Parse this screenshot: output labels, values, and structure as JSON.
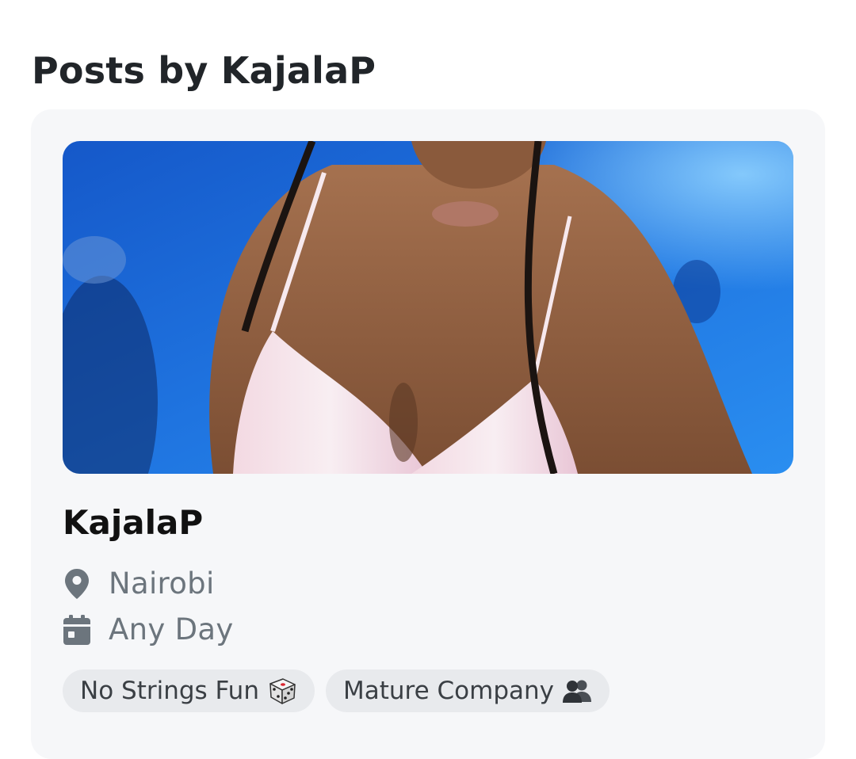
{
  "page": {
    "heading": "Posts by KajalaP"
  },
  "post": {
    "title": "KajalaP",
    "photo_icon": "profile-photo",
    "location": {
      "icon": "map-pin-icon",
      "text": "Nairobi"
    },
    "schedule": {
      "icon": "calendar-icon",
      "text": "Any Day"
    },
    "tags": [
      {
        "label": "No Strings Fun",
        "icon": "dice-icon"
      },
      {
        "label": "Mature Company",
        "icon": "people-icon"
      }
    ]
  },
  "colors": {
    "card_background": "#f6f7f9",
    "tag_background": "#e8eaed",
    "muted_text": "#6c757d",
    "photo_background": "#1f74e0"
  }
}
